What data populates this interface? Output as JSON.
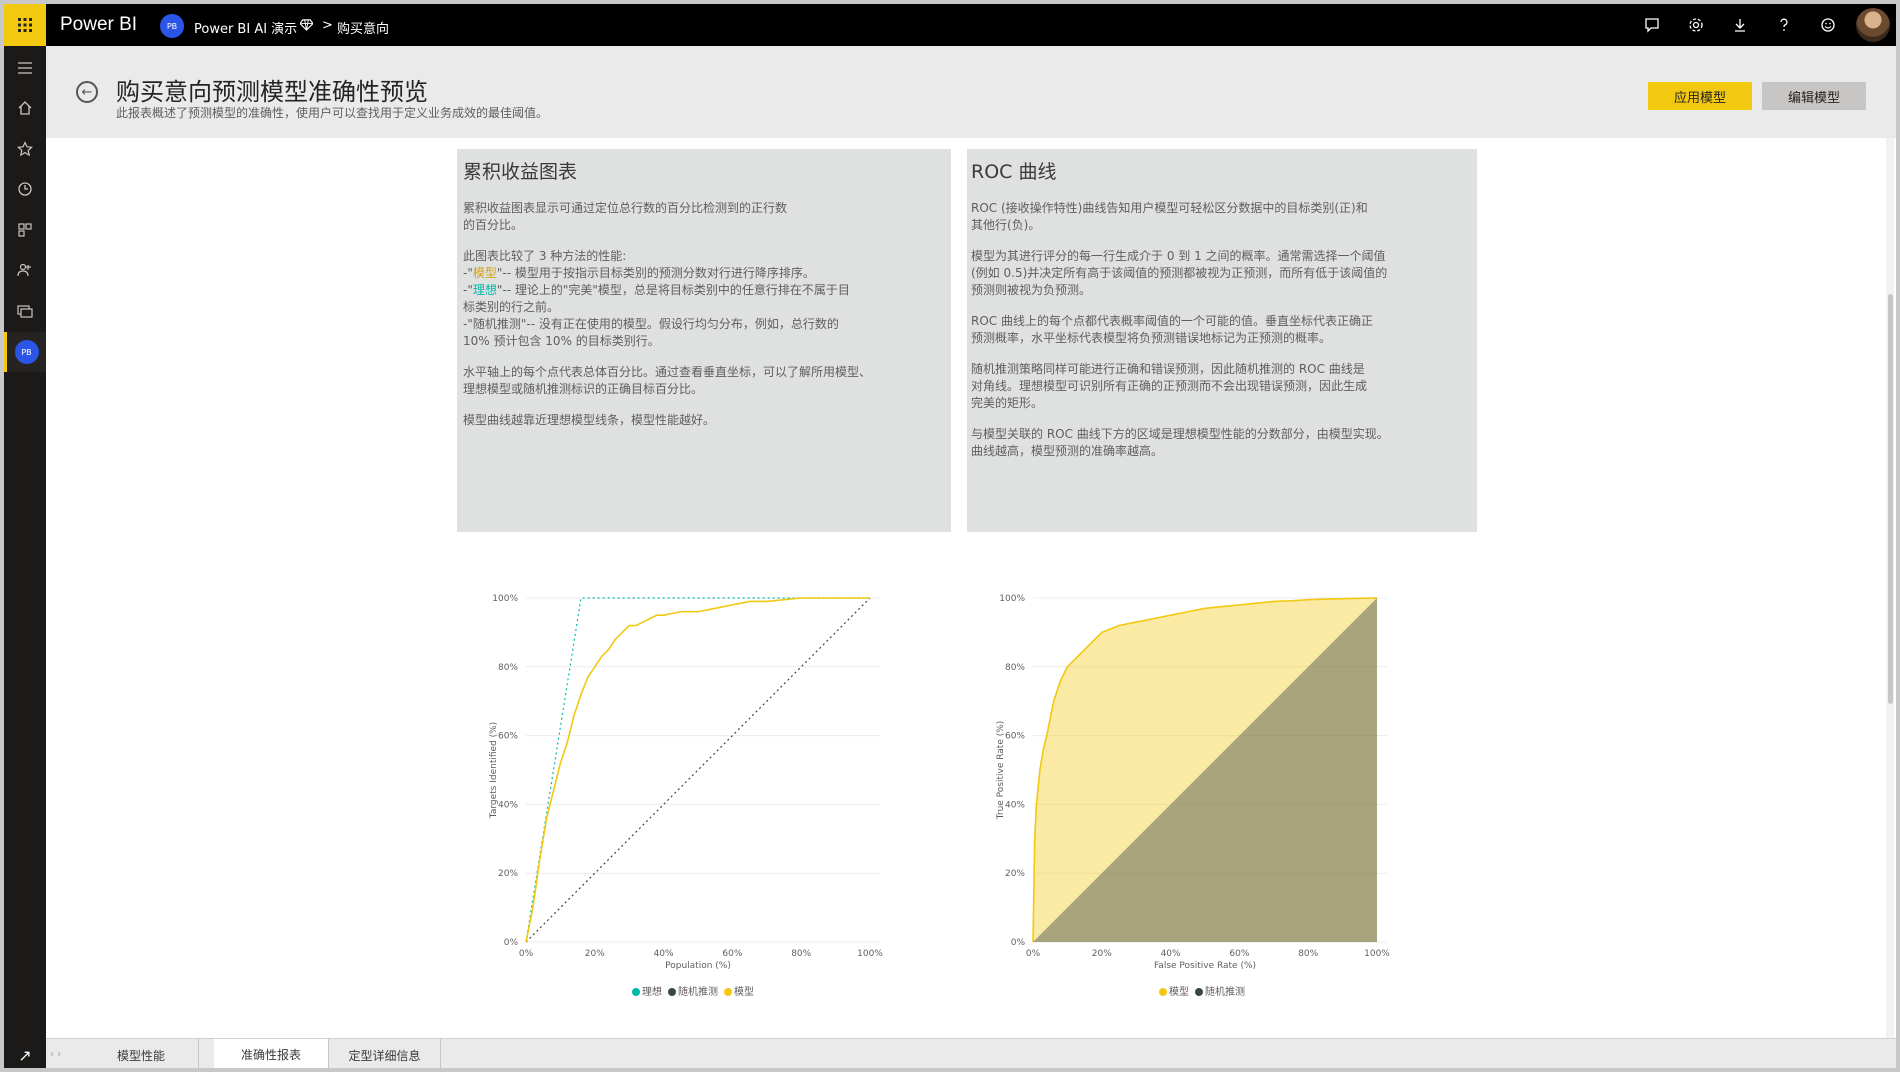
{
  "app": {
    "brand": "Power BI",
    "workspace_avatar": "PB",
    "workspace": "Power BI AI 演示",
    "breadcrumb_sep": ">",
    "item": "购买意向"
  },
  "topbar_icons": [
    "notification-icon",
    "settings-icon",
    "download-icon",
    "help-icon",
    "feedback-icon"
  ],
  "leftnav": {
    "items": [
      "hamburger-icon",
      "home-icon",
      "favorites-icon",
      "recent-icon",
      "apps-icon",
      "shared-icon",
      "workspaces-icon"
    ],
    "active_workspace": "PB"
  },
  "page": {
    "title": "购买意向预测模型准确性预览",
    "subtitle": "此报表概述了预测模型的准确性，使用户可以查找用于定义业务成效的最佳阈值。",
    "apply_label": "应用模型",
    "edit_label": "编辑模型"
  },
  "gain_card": {
    "title": "累积收益图表",
    "p1": "累积收益图表显示可通过定位总行数的百分比检测到的正行数\n的百分比。",
    "intro": "此图表比较了 3 种方法的性能:",
    "m1_a": "-\"",
    "m1_hl": "模型",
    "m1_b": "\"-- 模型用于按指示目标类别的预测分数对行进行降序排序。",
    "m2_a": "-\"",
    "m2_hl": "理想",
    "m2_b": "\"-- 理论上的\"完美\"模型，总是将目标类别中的任意行排在不属于目",
    "m2_c": "标类别的行之前。",
    "m3_a": "-\"随机推测\"-- 没有正在使用的模型。假设行均匀分布，例如，总行数的",
    "m3_b": "10% 预计包含 10% 的目标类别行。",
    "p3": "水平轴上的每个点代表总体百分比。通过查看垂直坐标，可以了解所用模型、\n理想模型或随机推测标识的正确目标百分比。",
    "p4": "模型曲线越靠近理想模型线条，模型性能越好。"
  },
  "roc_card": {
    "title": "ROC 曲线",
    "p1": "ROC (接收操作特性)曲线告知用户模型可轻松区分数据中的目标类别(正)和\n其他行(负)。",
    "p2": "模型为其进行评分的每一行生成介于 0 到 1 之间的概率。通常需选择一个阈值\n(例如 0.5)并决定所有高于该阈值的预测都被视为正预测，而所有低于该阈值的\n预测则被视为负预测。",
    "p3": "ROC 曲线上的每个点都代表概率阈值的一个可能的值。垂直坐标代表正确正\n预测概率，水平坐标代表模型将负预测错误地标记为正预测的概率。",
    "p4": "随机推测策略同样可能进行正确和错误预测，因此随机推测的 ROC 曲线是\n对角线。理想模型可识别所有正确的正预测而不会出现错误预测，因此生成\n完美的矩形。",
    "p5": "与模型关联的 ROC 曲线下方的区域是理想模型性能的分数部分，由模型实现。\n曲线越高，模型预测的准确率越高。"
  },
  "chart_data": [
    {
      "type": "line",
      "xlabel": "Population (%)",
      "ylabel": "Targets Identified (%)",
      "x_ticks": [
        "0%",
        "20%",
        "40%",
        "60%",
        "80%",
        "100%"
      ],
      "y_ticks": [
        "0%",
        "20%",
        "40%",
        "60%",
        "80%",
        "100%"
      ],
      "xlim": [
        0,
        100
      ],
      "ylim": [
        0,
        100
      ],
      "grid": true,
      "legend_position": "bottom",
      "series": [
        {
          "name": "理想",
          "color": "#01b8aa",
          "style": "dotted",
          "x": [
            0,
            16,
            100
          ],
          "y": [
            0,
            100,
            100
          ]
        },
        {
          "name": "随机推测",
          "color": "#374649",
          "style": "dotted",
          "x": [
            0,
            100
          ],
          "y": [
            0,
            100
          ]
        },
        {
          "name": "模型",
          "color": "#f2c811",
          "style": "solid",
          "x": [
            0,
            2,
            4,
            6,
            8,
            10,
            12,
            14,
            16,
            18,
            20,
            22,
            24,
            26,
            28,
            30,
            32,
            34,
            36,
            38,
            40,
            45,
            50,
            55,
            60,
            65,
            70,
            80,
            90,
            100
          ],
          "y": [
            0,
            10,
            24,
            36,
            44,
            52,
            58,
            66,
            72,
            77,
            80,
            83,
            85,
            88,
            90,
            92,
            92,
            93,
            94,
            95,
            95,
            96,
            96,
            97,
            98,
            99,
            99,
            100,
            100,
            100
          ]
        }
      ]
    },
    {
      "type": "area",
      "xlabel": "False Positive Rate (%)",
      "ylabel": "True Positive Rate (%)",
      "x_ticks": [
        "0%",
        "20%",
        "40%",
        "60%",
        "80%",
        "100%"
      ],
      "y_ticks": [
        "0%",
        "20%",
        "40%",
        "60%",
        "80%",
        "100%"
      ],
      "xlim": [
        0,
        100
      ],
      "ylim": [
        0,
        100
      ],
      "grid": true,
      "legend_position": "bottom",
      "series": [
        {
          "name": "模型",
          "color": "#f2c811",
          "x": [
            0,
            0.5,
            1,
            2,
            3,
            4,
            5,
            6,
            8,
            10,
            12,
            15,
            18,
            20,
            25,
            30,
            35,
            40,
            45,
            50,
            55,
            60,
            65,
            70,
            75,
            80,
            85,
            90,
            95,
            100
          ],
          "y": [
            0,
            30,
            40,
            50,
            56,
            60,
            65,
            70,
            76,
            80,
            82,
            85,
            88,
            90,
            92,
            93,
            94,
            95,
            96,
            97,
            97.5,
            98,
            98.5,
            99,
            99.2,
            99.5,
            99.7,
            99.8,
            99.9,
            100
          ]
        },
        {
          "name": "随机推测",
          "color": "#374649",
          "x": [
            0,
            100
          ],
          "y": [
            0,
            100
          ]
        }
      ]
    }
  ],
  "tabs": [
    {
      "label": "模型性能",
      "active": false
    },
    {
      "label": "准确性报表",
      "active": true
    },
    {
      "label": "定型详细信息",
      "active": false
    }
  ]
}
